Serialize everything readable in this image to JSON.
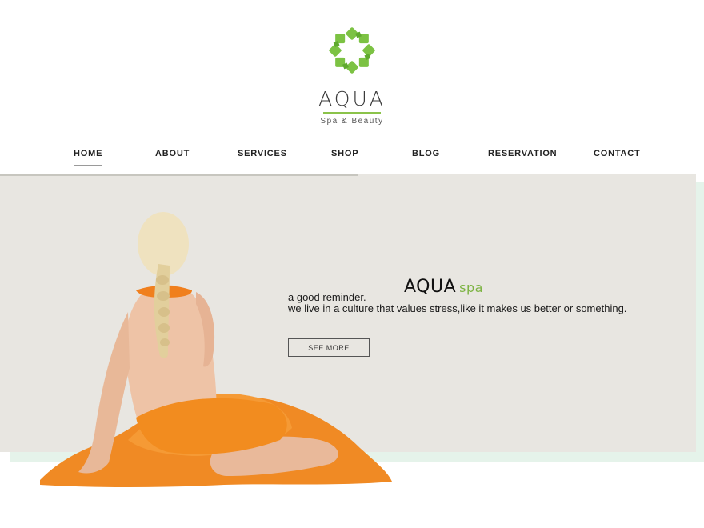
{
  "brand": {
    "logo_icon": "flower-leaf-logo-icon",
    "title": "AQUA",
    "subtitle": "Spa & Beauty",
    "accent_color": "#8bc34a"
  },
  "nav": {
    "items": [
      {
        "label": "HOME",
        "active": true
      },
      {
        "label": "ABOUT"
      },
      {
        "label": "SERVICES"
      },
      {
        "label": "SHOP"
      },
      {
        "label": "BLOG"
      },
      {
        "label": "RESERVATION"
      },
      {
        "label": "CONTACT"
      }
    ]
  },
  "hero": {
    "tagline": "a good reminder.",
    "brand_main": "AQUA",
    "brand_accent": "spa",
    "body": "we live in a culture that values stress,like it makes us better or something.",
    "button_label": "SEE MORE",
    "image_icon": "woman-with-towel-image",
    "background_color": "#e8e6e1",
    "towel_color": "#f08a24"
  }
}
